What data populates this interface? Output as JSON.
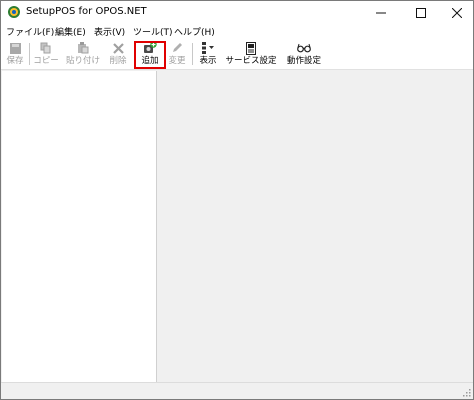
{
  "window": {
    "title": "SetupPOS for OPOS.NET",
    "icons": {
      "app": "app-logo-icon",
      "minimize": "minimize-icon",
      "maximize": "maximize-icon",
      "close": "close-icon"
    }
  },
  "menu": {
    "items": [
      {
        "label": "ファイル(F)"
      },
      {
        "label": "編集(E)"
      },
      {
        "label": "表示(V)"
      },
      {
        "label": "ツール(T)"
      },
      {
        "label": "ヘルプ(H)"
      }
    ]
  },
  "toolbar": {
    "buttons": [
      {
        "label": "保存",
        "icon": "save-icon",
        "enabled": false
      },
      {
        "label": "コピー",
        "icon": "copy-icon",
        "enabled": false
      },
      {
        "label": "貼り付け",
        "icon": "paste-icon",
        "enabled": false
      },
      {
        "label": "削除",
        "icon": "delete-icon",
        "enabled": false
      },
      {
        "label": "追加",
        "icon": "add-device-icon",
        "enabled": true,
        "highlighted": true
      },
      {
        "label": "変更",
        "icon": "edit-pencil-icon",
        "enabled": false
      },
      {
        "label": "表示",
        "icon": "view-list-icon",
        "enabled": true
      },
      {
        "label": "サービス設定",
        "icon": "service-settings-icon",
        "enabled": true
      },
      {
        "label": "動作設定",
        "icon": "glasses-icon",
        "enabled": true
      }
    ]
  },
  "colors": {
    "highlight_border": "#e00000",
    "disabled_text": "#a0a0a0",
    "window_bg": "#f0f0f0"
  }
}
